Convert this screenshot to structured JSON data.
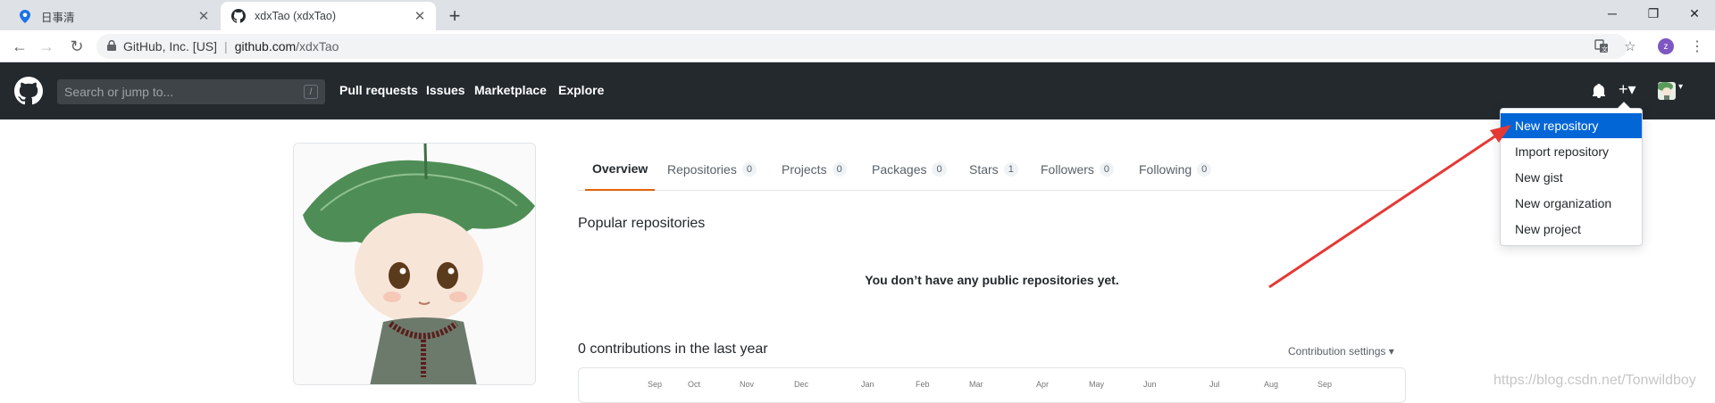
{
  "browser": {
    "tabs": [
      {
        "title": "日事清",
        "icon": "map-pin-icon",
        "close": "✕"
      },
      {
        "title": "xdxTao (xdxTao)",
        "icon": "github-octocat-icon",
        "close": "✕"
      }
    ],
    "new_tab": "+",
    "window_controls": {
      "minimize": "─",
      "maximize": "❐",
      "close": "✕"
    },
    "nav": {
      "back": "←",
      "forward": "→",
      "reload": "↻"
    },
    "address": {
      "org": "GitHub, Inc. [US]",
      "separator": "|",
      "domain": "github.com",
      "path": "/xdxTao"
    },
    "profile_initial": "z",
    "menu": "⋮",
    "colors": {
      "tabbar": "#dee1e6",
      "profile": "#7e57c2"
    }
  },
  "github_header": {
    "search_placeholder": "Search or jump to...",
    "search_shortcut": "/",
    "nav": [
      "Pull requests",
      "Issues",
      "Marketplace",
      "Explore"
    ],
    "bell": "notifications-icon",
    "plus": "+▾",
    "avatar_caret": "▾",
    "colors": {
      "background": "#24292e"
    }
  },
  "new_menu": {
    "items": [
      "New repository",
      "Import repository",
      "New gist",
      "New organization",
      "New project"
    ],
    "selected": "New repository",
    "colors": {
      "selected": "#0366d6"
    }
  },
  "profile_tabs": [
    {
      "label": "Overview",
      "count": null
    },
    {
      "label": "Repositories",
      "count": "0"
    },
    {
      "label": "Projects",
      "count": "0"
    },
    {
      "label": "Packages",
      "count": "0"
    },
    {
      "label": "Stars",
      "count": "1"
    },
    {
      "label": "Followers",
      "count": "0"
    },
    {
      "label": "Following",
      "count": "0"
    }
  ],
  "main": {
    "popular_title": "Popular repositories",
    "no_repos": "You don’t have any public repositories yet.",
    "contributions_title": "0 contributions in the last year",
    "contribution_settings": "Contribution settings ▾",
    "months": [
      "Sep",
      "Oct",
      "Nov",
      "Dec",
      "Jan",
      "Feb",
      "Mar",
      "Apr",
      "May",
      "Jun",
      "Jul",
      "Aug",
      "Sep"
    ]
  },
  "watermark": "https://blog.csdn.net/Tonwildboy",
  "annotation_color": "#e53935"
}
